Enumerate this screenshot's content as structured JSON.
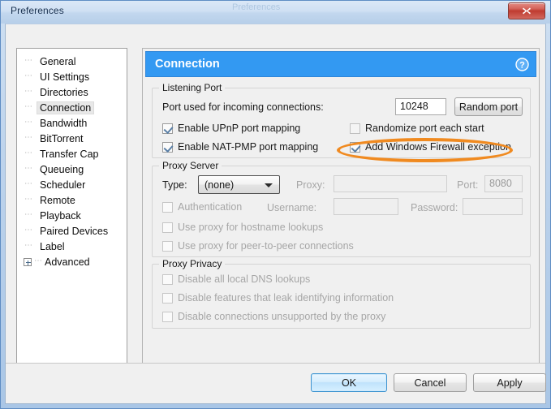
{
  "window": {
    "title": "Preferences",
    "ghost_text": "Preferences",
    "close_label": "Close"
  },
  "sidebar": {
    "items": [
      {
        "label": "General",
        "selected": false,
        "expandable": false
      },
      {
        "label": "UI Settings",
        "selected": false,
        "expandable": false
      },
      {
        "label": "Directories",
        "selected": false,
        "expandable": false
      },
      {
        "label": "Connection",
        "selected": true,
        "expandable": false
      },
      {
        "label": "Bandwidth",
        "selected": false,
        "expandable": false
      },
      {
        "label": "BitTorrent",
        "selected": false,
        "expandable": false
      },
      {
        "label": "Transfer Cap",
        "selected": false,
        "expandable": false
      },
      {
        "label": "Queueing",
        "selected": false,
        "expandable": false
      },
      {
        "label": "Scheduler",
        "selected": false,
        "expandable": false
      },
      {
        "label": "Remote",
        "selected": false,
        "expandable": false
      },
      {
        "label": "Playback",
        "selected": false,
        "expandable": false
      },
      {
        "label": "Paired Devices",
        "selected": false,
        "expandable": false
      },
      {
        "label": "Label",
        "selected": false,
        "expandable": false
      },
      {
        "label": "Advanced",
        "selected": false,
        "expandable": true
      }
    ]
  },
  "panel": {
    "title": "Connection",
    "help_icon": "question-mark-icon"
  },
  "listening_port": {
    "group_title": "Listening Port",
    "port_label": "Port used for incoming connections:",
    "port_value": "10248",
    "random_port_button": "Random port",
    "upnp_label": "Enable UPnP port mapping",
    "natpmp_label": "Enable NAT-PMP port mapping",
    "randomize_label": "Randomize port each start",
    "firewall_label": "Add Windows Firewall exception"
  },
  "proxy_server": {
    "group_title": "Proxy Server",
    "type_label": "Type:",
    "type_value": "(none)",
    "proxy_label": "Proxy:",
    "proxy_value": "",
    "port_label": "Port:",
    "port_value": "8080",
    "authentication_label": "Authentication",
    "username_label": "Username:",
    "username_value": "",
    "password_label": "Password:",
    "password_value": "",
    "hostname_lookups_label": "Use proxy for hostname lookups",
    "p2p_label": "Use proxy for peer-to-peer connections"
  },
  "proxy_privacy": {
    "group_title": "Proxy Privacy",
    "dns_label": "Disable all local DNS lookups",
    "leak_label": "Disable features that leak identifying information",
    "unsupported_label": "Disable connections unsupported by the proxy"
  },
  "footer": {
    "ok": "OK",
    "cancel": "Cancel",
    "apply": "Apply"
  },
  "colors": {
    "accent": "#3399f2",
    "annotation": "#f08a20",
    "close_button": "#bf3b30"
  }
}
